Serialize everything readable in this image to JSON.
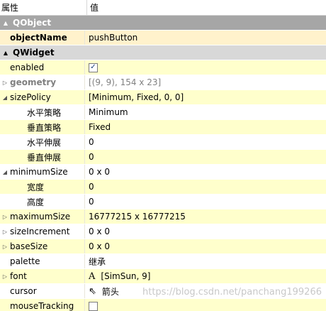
{
  "header": {
    "col_property": "属性",
    "col_value": "值"
  },
  "groups": {
    "qobject": "QObject",
    "qwidget": "QWidget"
  },
  "rows": {
    "objectName": {
      "name": "objectName",
      "value": "pushButton"
    },
    "enabled": {
      "name": "enabled",
      "checked": true,
      "check_glyph": "✓"
    },
    "geometry": {
      "name": "geometry",
      "value": "[(9, 9), 154 x 23]"
    },
    "sizePolicy": {
      "name": "sizePolicy",
      "value": "[Minimum, Fixed, 0, 0]"
    },
    "hPolicy": {
      "name": "水平策略",
      "value": "Minimum"
    },
    "vPolicy": {
      "name": "垂直策略",
      "value": "Fixed"
    },
    "hStretch": {
      "name": "水平伸展",
      "value": "0"
    },
    "vStretch": {
      "name": "垂直伸展",
      "value": "0"
    },
    "minimumSize": {
      "name": "minimumSize",
      "value": "0 x 0"
    },
    "minWidth": {
      "name": "宽度",
      "value": "0"
    },
    "minHeight": {
      "name": "高度",
      "value": "0"
    },
    "maximumSize": {
      "name": "maximumSize",
      "value": "16777215 x 16777215"
    },
    "sizeIncrement": {
      "name": "sizeIncrement",
      "value": "0 x 0"
    },
    "baseSize": {
      "name": "baseSize",
      "value": "0 x 0"
    },
    "palette": {
      "name": "palette",
      "value": "继承"
    },
    "font": {
      "name": "font",
      "icon_glyph": "A",
      "value": "[SimSun, 9]"
    },
    "cursor": {
      "name": "cursor",
      "icon_glyph": "⇖",
      "value": "箭头"
    },
    "mouseTracking": {
      "name": "mouseTracking",
      "checked": false
    }
  },
  "glyphs": {
    "expand_open": "◢",
    "expand_closed": "▷",
    "group_arrow": "▲"
  },
  "watermark": "https://blog.csdn.net/panchang199266",
  "colors": {
    "row_yellow": "#ffffcc",
    "group_dark": "#a6a6a6",
    "group_light": "#d8d8d8"
  }
}
